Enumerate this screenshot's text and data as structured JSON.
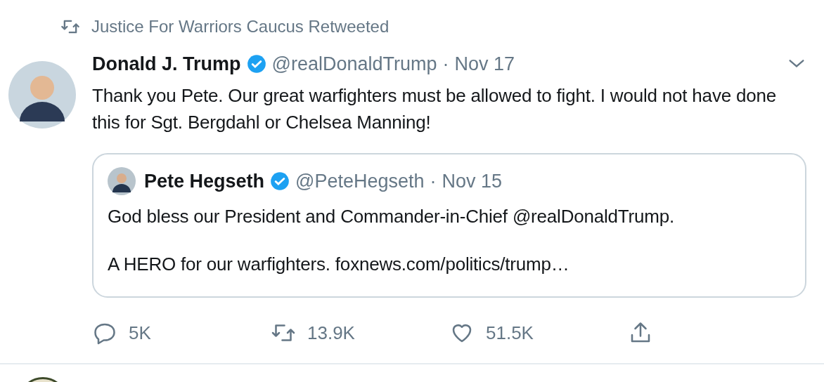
{
  "retweet_context": {
    "label": "Justice For Warriors Caucus Retweeted"
  },
  "tweet": {
    "name": "Donald J. Trump",
    "verified": true,
    "handle": "@realDonaldTrump",
    "separator": "·",
    "date": "Nov 17",
    "text": "Thank you Pete. Our great warfighters must be allowed to fight. I would not have done this for Sgt. Bergdahl or Chelsea Manning!",
    "quoted": {
      "name": "Pete Hegseth",
      "verified": true,
      "handle": "@PeteHegseth",
      "separator": "·",
      "date": "Nov 15",
      "lines": [
        "God bless our President and Commander-in-Chief @realDonaldTrump.",
        "A HERO for our warfighters. foxnews.com/politics/trump…"
      ]
    },
    "actions": [
      {
        "kind": "reply",
        "count": "5K"
      },
      {
        "kind": "retweet",
        "count": "13.9K"
      },
      {
        "kind": "like",
        "count": "51.5K"
      },
      {
        "kind": "share"
      }
    ]
  }
}
